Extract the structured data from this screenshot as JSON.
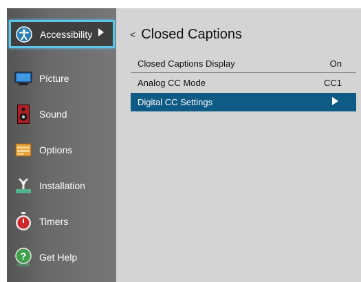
{
  "sidebar": {
    "items": [
      {
        "label": "Accessibility",
        "icon": "accessibility-icon",
        "selected": true
      },
      {
        "label": "Picture",
        "icon": "monitor-icon"
      },
      {
        "label": "Sound",
        "icon": "speaker-icon"
      },
      {
        "label": "Options",
        "icon": "options-icon"
      },
      {
        "label": "Installation",
        "icon": "installation-icon"
      },
      {
        "label": "Timers",
        "icon": "stopwatch-icon"
      },
      {
        "label": "Get Help",
        "icon": "help-icon"
      }
    ]
  },
  "main": {
    "back_glyph": "<",
    "title": "Closed Captions",
    "rows": [
      {
        "label": "Closed Captions Display",
        "value": "On"
      },
      {
        "label": "Analog CC Mode",
        "value": "CC1"
      },
      {
        "label": "Digital CC Settings",
        "value": "",
        "highlighted": true
      }
    ]
  },
  "colors": {
    "selection_border": "#5bc6ea",
    "row_highlight": "#0e5b86",
    "panel_background": "#d4d4d4"
  }
}
